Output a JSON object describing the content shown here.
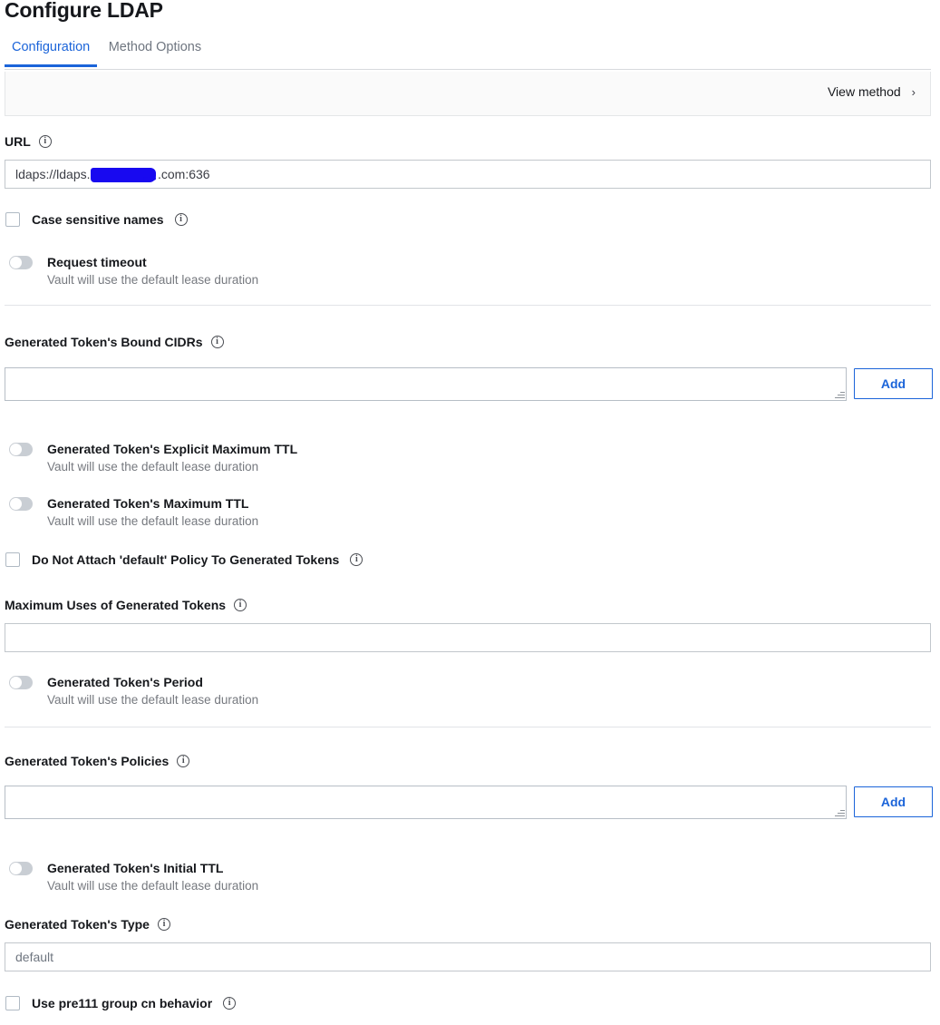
{
  "page": {
    "title": "Configure LDAP"
  },
  "tabs": [
    {
      "label": "Configuration",
      "active": true
    },
    {
      "label": "Method Options",
      "active": false
    }
  ],
  "toolbar": {
    "view_method_label": "View method",
    "chevron": "›"
  },
  "icons": {
    "info": "i"
  },
  "colors": {
    "accent": "#1b64d9",
    "redaction": "#1809f0",
    "label": "#16181c",
    "help_text": "#76797f",
    "toolbar_bg": "#fafafa"
  },
  "fields": {
    "url": {
      "label": "URL",
      "value": "ldaps://ldaps.",
      "value_tail": ".com:636",
      "redacted": true,
      "placeholder": ""
    },
    "case_sensitive_names": {
      "label": "Case sensitive names",
      "checked": false
    },
    "request_timeout": {
      "label": "Request timeout",
      "help": "Vault will use the default lease duration",
      "on": false
    },
    "bound_cidrs": {
      "label": "Generated Token's Bound CIDRs",
      "value": "",
      "add_label": "Add"
    },
    "explicit_max_ttl": {
      "label": "Generated Token's Explicit Maximum TTL",
      "help": "Vault will use the default lease duration",
      "on": false
    },
    "max_ttl": {
      "label": "Generated Token's Maximum TTL",
      "help": "Vault will use the default lease duration",
      "on": false
    },
    "no_default_policy": {
      "label": "Do Not Attach 'default' Policy To Generated Tokens",
      "checked": false
    },
    "num_uses": {
      "label": "Maximum Uses of Generated Tokens",
      "value": "",
      "placeholder": ""
    },
    "period": {
      "label": "Generated Token's Period",
      "help": "Vault will use the default lease duration",
      "on": false
    },
    "policies": {
      "label": "Generated Token's Policies",
      "value": "",
      "add_label": "Add"
    },
    "initial_ttl": {
      "label": "Generated Token's Initial TTL",
      "help": "Vault will use the default lease duration",
      "on": false
    },
    "token_type": {
      "label": "Generated Token's Type",
      "value": "default",
      "placeholder": "default"
    },
    "pre111_group_cn": {
      "label": "Use pre111 group cn behavior",
      "checked": false
    }
  }
}
